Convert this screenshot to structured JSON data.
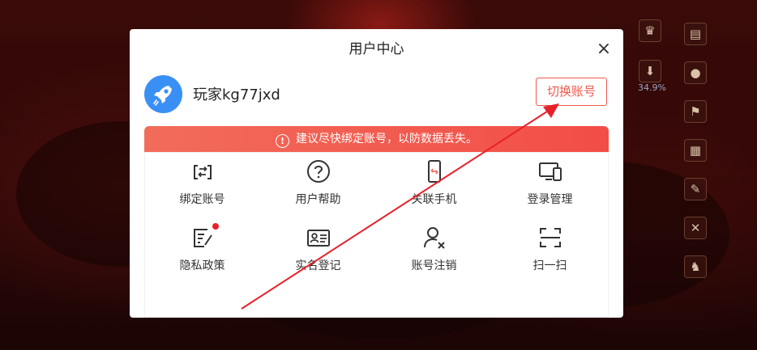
{
  "modal": {
    "title": "用户中心",
    "close_glyph": "×",
    "username": "玩家kg77jxd",
    "switch_account_label": "切换账号",
    "banner_text": "建议尽快绑定账号，以防数据丢失。",
    "banner_icon_glyph": "!",
    "items": [
      {
        "label": "绑定账号",
        "icon": "bind-icon"
      },
      {
        "label": "用户帮助",
        "icon": "help-icon"
      },
      {
        "label": "关联手机",
        "icon": "phone-icon"
      },
      {
        "label": "登录管理",
        "icon": "devices-icon"
      },
      {
        "label": "隐私政策",
        "icon": "privacy-icon"
      },
      {
        "label": "实名登记",
        "icon": "id-card-icon"
      },
      {
        "label": "账号注销",
        "icon": "user-remove-icon"
      },
      {
        "label": "扫一扫",
        "icon": "scan-icon"
      }
    ]
  },
  "side": {
    "download_percent": "34.9%"
  },
  "colors": {
    "accent": "#f05a4c",
    "avatar_bg": "#3a8ff5",
    "annotation_arrow": "#e8202a"
  }
}
